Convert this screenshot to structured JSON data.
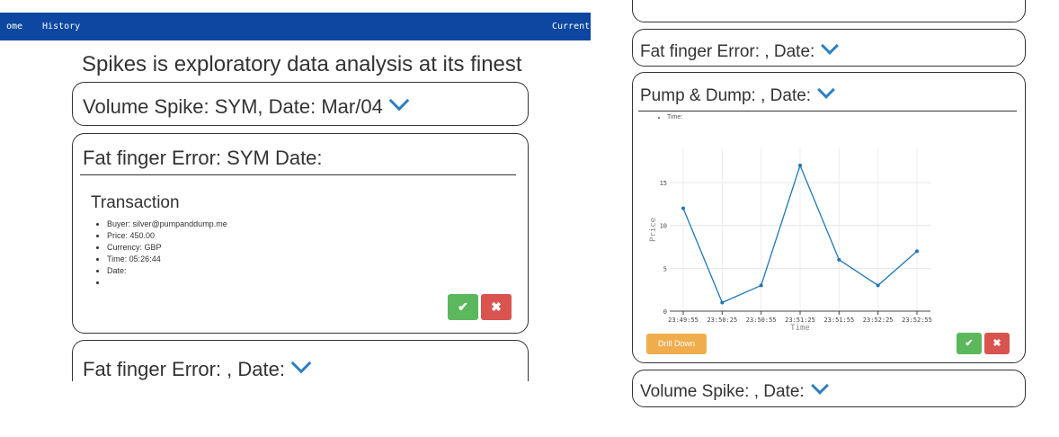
{
  "nav": {
    "home": "ome",
    "history": "History",
    "current": "Current A"
  },
  "page_title": "Spikes is exploratory data analysis at its finest",
  "left_cards": {
    "volume_spike_head": "Volume Spike: SYM, Date: Mar/04",
    "fat_finger_head": "Fat finger Error: SYM Date:",
    "fat_finger_2_head": "Fat finger Error: , Date:"
  },
  "transaction": {
    "title": "Transaction",
    "items": [
      "Buyer: silver@pumpanddump.me",
      "Price: 450.00",
      "Currency: GBP",
      "Time: 05:26:44",
      "Date:",
      ""
    ]
  },
  "buttons": {
    "accept_icon": "✔",
    "reject_icon": "✖",
    "drill_down": "Drill Down"
  },
  "right_cards": {
    "fat_finger_head": "Fat finger Error: , Date:",
    "pump_dump_head": "Pump & Dump: , Date:",
    "time_item": "Time:",
    "volume_spike_head": "Volume Spike: , Date:"
  },
  "colors": {
    "navbar": "#0d47a1",
    "chevron": "#2f7fc1",
    "accept": "#5cb85c",
    "reject": "#d9534f",
    "drill": "#f0ad4e",
    "line": "#1f77b4"
  },
  "chart_data": {
    "type": "line",
    "x": [
      "23:49:55",
      "23:50:25",
      "23:50:55",
      "23:51:25",
      "23:51:55",
      "23:52:25",
      "23:52:55"
    ],
    "series": [
      {
        "values": [
          12,
          1,
          3,
          17,
          6,
          3,
          7
        ]
      }
    ],
    "xlabel": "Time",
    "ylabel": "Price",
    "yticks": [
      "0",
      "5",
      "10",
      "15"
    ],
    "ylim": [
      0,
      19
    ],
    "grid": true
  }
}
